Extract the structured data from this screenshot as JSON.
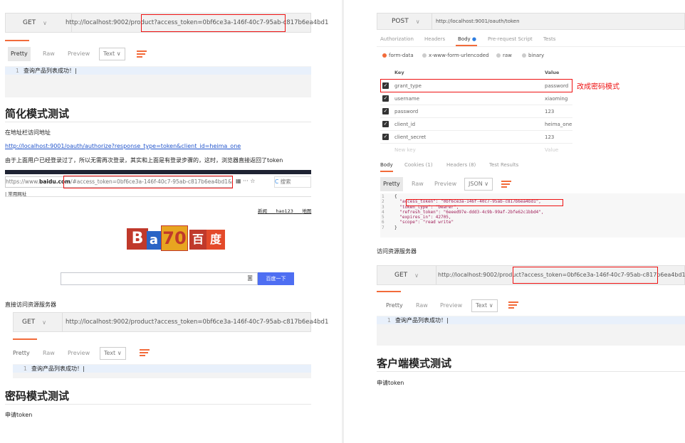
{
  "left": {
    "top_request": {
      "method": "GET",
      "url_prefix": "http://localhost:9002/product",
      "url_token": "?access_token=0bf6ce3a-146f-40c7-95ab-c817b6ea4bd1"
    },
    "top_response": {
      "tabs": [
        "Pretty",
        "Raw",
        "Preview"
      ],
      "format": "Text",
      "line_no": "1",
      "line_text": "查询产品列表成功！|"
    },
    "heading1": "简化模式测试",
    "para1": "在地址栏访问地址",
    "link1": "http://localhost:9001/oauth/authorize?response_type=token&client_id=heima_one",
    "para2": "由于上面用户已经登录过了，所以无需再次登录，其实和上面是有登录步骤的，这时，浏览器直接返回了token",
    "browser": {
      "url_host": "https://www.",
      "url_domain": "baidu.com",
      "url_fragment": "/#access_token=0bf6ce3a-146f-40c7-95ab-c817b6ea4bd1&token",
      "search_label": "搜索",
      "bookmark": "常用网址",
      "links": [
        "新闻",
        "hao123",
        "地图"
      ],
      "logo_text": "B  70 百度",
      "search_button": "百度一下"
    },
    "para3": "直接访问资源服务器",
    "bottom_request": {
      "method": "GET",
      "url": "http://localhost:9002/product?access_token=0bf6ce3a-146f-40c7-95ab-c817b6ea4bd1"
    },
    "bottom_response": {
      "tabs": [
        "Pretty",
        "Raw",
        "Preview"
      ],
      "format": "Text",
      "line_no": "1",
      "line_text": "查询产品列表成功！|"
    },
    "heading2": "密码模式测试",
    "para4": "申请token"
  },
  "right": {
    "request": {
      "method": "POST",
      "url": "http://localhost:9001/oauth/token"
    },
    "req_tabs": [
      "Authorization",
      "Headers",
      "Body",
      "Pre-request Script",
      "Tests"
    ],
    "body_modes": [
      "form-data",
      "x-www-form-urlencoded",
      "raw",
      "binary"
    ],
    "table_headers": {
      "key": "Key",
      "value": "Value"
    },
    "rows": [
      {
        "key": "grant_type",
        "value": "password"
      },
      {
        "key": "username",
        "value": "xiaoming"
      },
      {
        "key": "password",
        "value": "123"
      },
      {
        "key": "client_id",
        "value": "heima_one"
      },
      {
        "key": "client_secret",
        "value": "123"
      }
    ],
    "new_key": "New key",
    "new_value": "Value",
    "annotation": "改成密码模式",
    "resp_tabs": {
      "body": "Body",
      "cookies": "Cookies (1)",
      "headers": "Headers (8)",
      "tests": "Test Results"
    },
    "resp_view": {
      "tabs": [
        "Pretty",
        "Raw",
        "Preview"
      ],
      "format": "JSON"
    },
    "json_lines": [
      {
        "n": "1",
        "t": "{"
      },
      {
        "n": "2",
        "t": "  \"access_token\": \"0bf6ce3a-146f-40c7-95ab-c817b6ea4bd1\","
      },
      {
        "n": "3",
        "t": "  \"token_type\": \"bearer\","
      },
      {
        "n": "4",
        "t": "  \"refresh_token\": \"6eeed97e-ddd3-4c9b-99af-2bfe62c1bbd4\","
      },
      {
        "n": "5",
        "t": "  \"expires_in\": 42705,"
      },
      {
        "n": "6",
        "t": "  \"scope\": \"read write\""
      },
      {
        "n": "7",
        "t": "}"
      }
    ],
    "para_access": "访问资源服务器",
    "request2": {
      "method": "GET",
      "url_prefix": "http://localhost:9002/product",
      "url_token": "?access_token=0bf6ce3a-146f-40c7-95ab-c817b6ea4bd1"
    },
    "response2": {
      "tabs": [
        "Pretty",
        "Raw",
        "Preview"
      ],
      "format": "Text",
      "line_no": "1",
      "line_text": "查询产品列表成功！|"
    },
    "heading3": "客户端模式测试",
    "para_last": "申请token"
  },
  "colors": {
    "accent": "#f26b3a",
    "highlight": "#e11111",
    "link": "#2255cc",
    "baidu_blue": "#4e6ef2"
  }
}
